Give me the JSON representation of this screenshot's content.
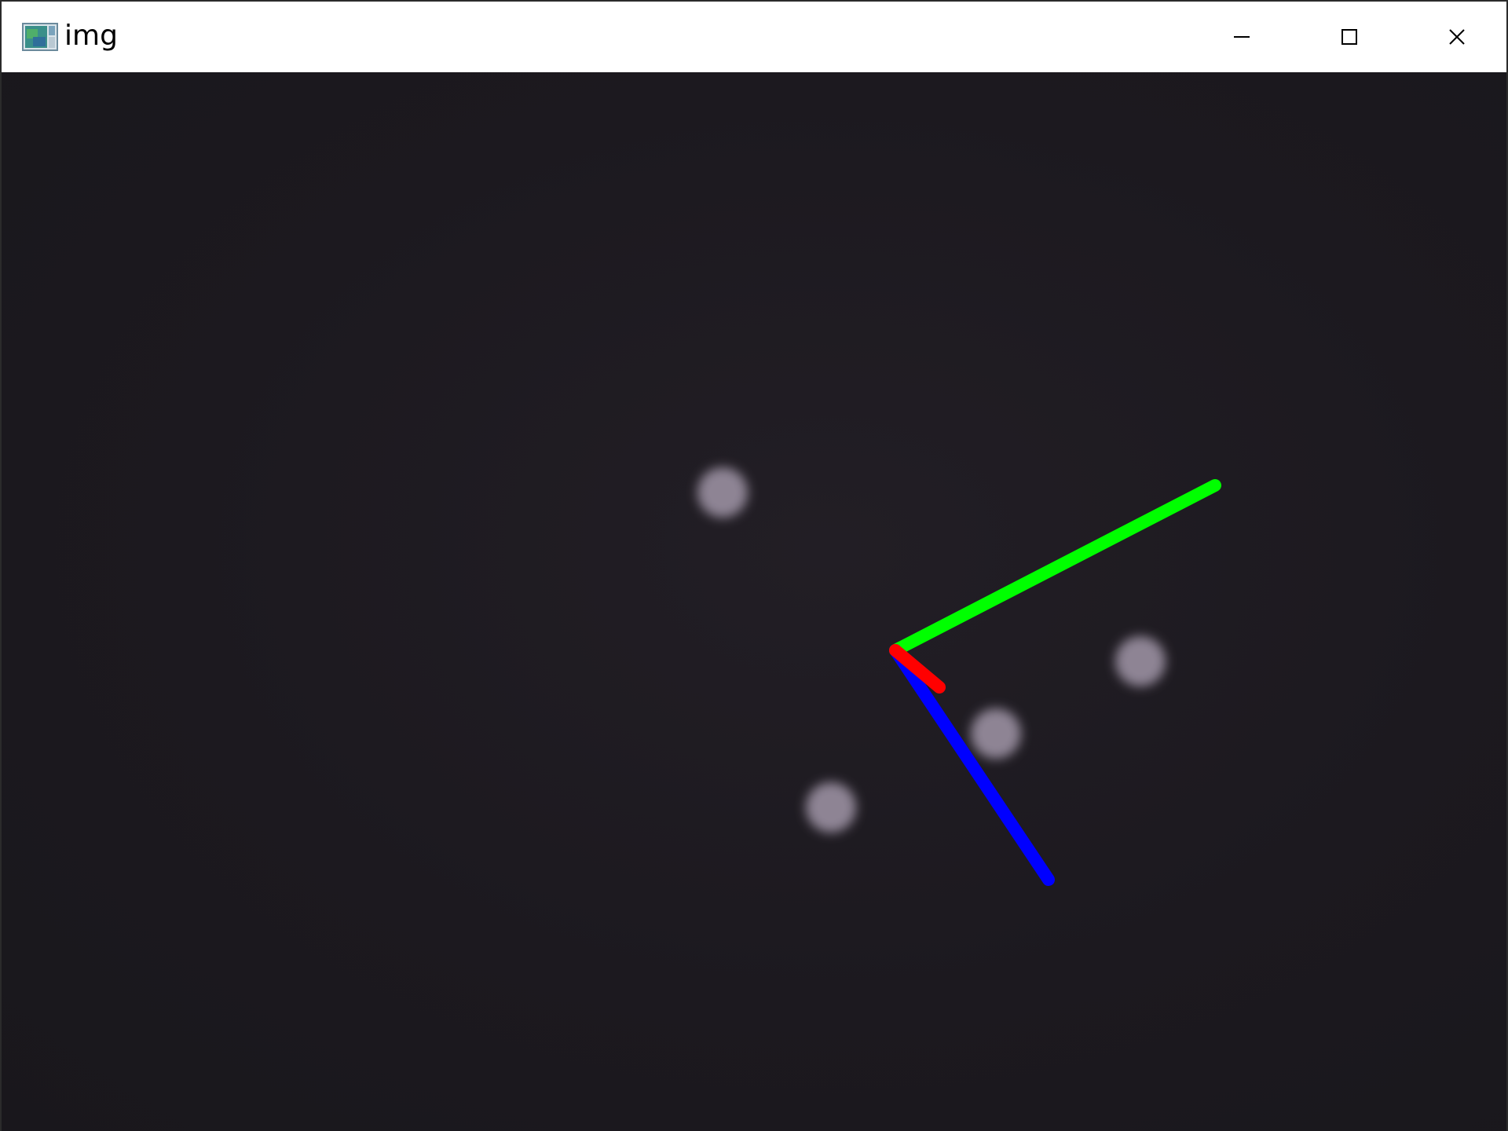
{
  "window": {
    "title": "img",
    "icon": "image-window-icon",
    "controls": {
      "minimize_icon": "minimize-icon",
      "maximize_icon": "maximize-icon",
      "close_icon": "close-icon"
    }
  },
  "colors": {
    "background": "#1b181e",
    "marker": "#8e8494",
    "axis_x": "#ff0000",
    "axis_y": "#00ff00",
    "axis_z": "#0000ff"
  }
}
